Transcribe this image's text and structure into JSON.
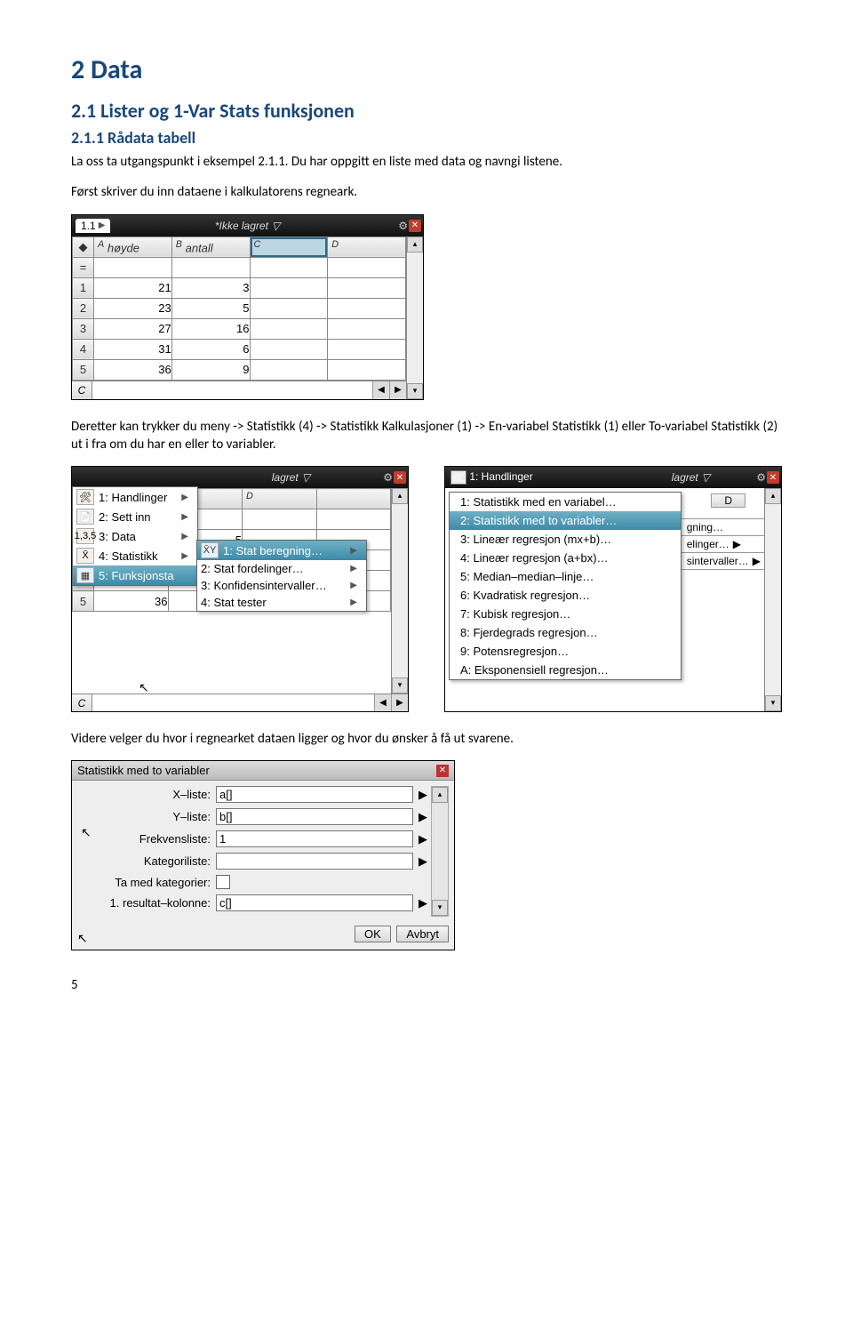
{
  "headings": {
    "h1": "2  Data",
    "h2": "2.1  Lister og 1-Var Stats funksjonen",
    "h3": "2.1.1  Rådata tabell"
  },
  "paragraphs": {
    "p1": "La oss ta utgangspunkt i eksempel 2.1.1. Du har oppgitt en liste med data og navngi listene.",
    "p2": "Først skriver du inn dataene i kalkulatorens regneark.",
    "p3": "Deretter kan trykker du meny -> Statistikk (4) -> Statistikk Kalkulasjoner (1) -> En-variabel Statistikk (1) eller To-variabel Statistikk (2) ut i fra om du har en eller to variabler.",
    "p4": "Videre velger du hvor i regnearket dataen ligger og hvor du ønsker å få ut svarene."
  },
  "calc_doc": {
    "tab": "1.1",
    "doc_title": "*Ikke lagret"
  },
  "sheet1": {
    "col_labels": [
      "A",
      "B",
      "C",
      "D"
    ],
    "col_names": [
      "høyde",
      "antall",
      "",
      ""
    ],
    "rows": [
      [
        "21",
        "3",
        "",
        ""
      ],
      [
        "23",
        "5",
        "",
        ""
      ],
      [
        "27",
        "16",
        "",
        ""
      ],
      [
        "31",
        "6",
        "",
        ""
      ],
      [
        "36",
        "9",
        "",
        ""
      ]
    ],
    "cell_ref": "C"
  },
  "menu_main": [
    "1: Handlinger",
    "2: Sett inn",
    "3: Data",
    "4: Statistikk",
    "5: Funksjonsta"
  ],
  "menu_stat": [
    "1: Stat beregning…",
    "2: Stat fordelinger…",
    "3: Konfidensintervaller…",
    "4: Stat tester"
  ],
  "menu_main_active_index": 4,
  "menu_stat_active_index": 0,
  "menu_reg_column_right": [
    "gning…",
    "elinger…",
    "sintervaller…"
  ],
  "menu_regression": [
    "1: Statistikk med en variabel…",
    "2: Statistikk med to variabler…",
    "3: Lineær regresjon (mx+b)…",
    "4: Lineær regresjon (a+bx)…",
    "5: Median–median–linje…",
    "6: Kvadratisk regresjon…",
    "7: Kubisk regresjon…",
    "8: Fjerdegrads regresjon…",
    "9: Potensregresjon…",
    "A: Eksponensiell regresjon…"
  ],
  "menu_regression_active_index": 1,
  "calc3_top_label": "1: Handlinger",
  "calc3_doc": "lagret",
  "dialog": {
    "title": "Statistikk med to variabler",
    "fields": [
      {
        "label": "X–liste:",
        "value": "a[]"
      },
      {
        "label": "Y–liste:",
        "value": "b[]"
      },
      {
        "label": "Frekvensliste:",
        "value": "1"
      },
      {
        "label": "Kategoriliste:",
        "value": ""
      }
    ],
    "checkbox_label": "Ta med kategorier:",
    "result_label": "1.  resultat–kolonne:",
    "result_value": "c[]",
    "ok": "OK",
    "cancel": "Avbryt"
  },
  "page_number": "5"
}
